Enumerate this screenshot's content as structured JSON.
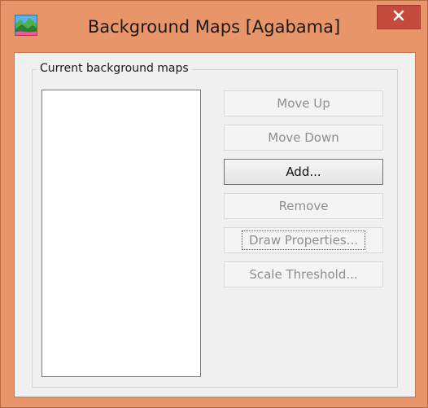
{
  "window": {
    "title": "Background Maps [Agabama]",
    "app_icon": "map-landscape-icon",
    "close_icon": "close-x-icon"
  },
  "group": {
    "label": "Current background maps",
    "list_items": []
  },
  "buttons": {
    "move_up": "Move Up",
    "move_down": "Move Down",
    "add": "Add...",
    "remove": "Remove",
    "draw_properties": "Draw Properties...",
    "scale_threshold": "Scale Threshold..."
  },
  "colors": {
    "title_bar": "#e8956a",
    "close_button": "#c44a3c",
    "dialog_background": "#f0f0f0"
  }
}
